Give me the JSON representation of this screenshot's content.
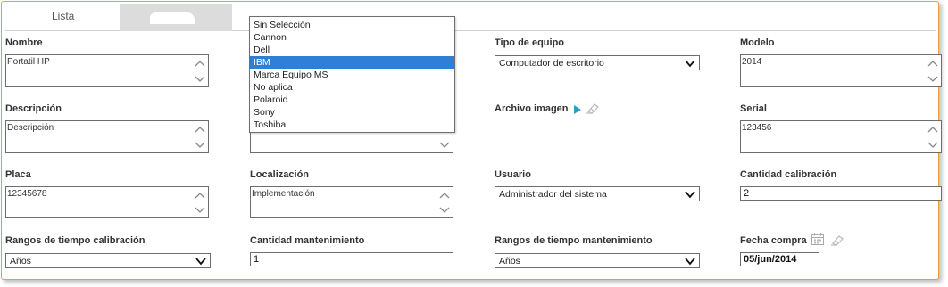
{
  "tabs": {
    "lista": "Lista"
  },
  "form": {
    "nombre": {
      "label": "Nombre",
      "value": "Portatil HP"
    },
    "marca_dropdown": {
      "options": [
        "Sin Selección",
        "Cannon",
        "Dell",
        "IBM",
        "Marca Equipo MS",
        "No aplica",
        "Polaroid",
        "Sony",
        "Toshiba"
      ],
      "selected_index": 3
    },
    "tipo_equipo": {
      "label": "Tipo de equipo",
      "value": "Computador de escritorio"
    },
    "modelo": {
      "label": "Modelo",
      "value": "2014"
    },
    "descripcion": {
      "label": "Descripción",
      "value": "Descripción"
    },
    "archivo_imagen": {
      "label": "Archivo imagen"
    },
    "serial": {
      "label": "Serial",
      "value": "123456"
    },
    "placa": {
      "label": "Placa",
      "value": "12345678"
    },
    "localizacion": {
      "label": "Localización",
      "value": "Implementación"
    },
    "usuario": {
      "label": "Usuario",
      "value": "Administrador del sistema"
    },
    "cantidad_calibracion": {
      "label": "Cantidad calibración",
      "value": "2"
    },
    "rangos_calibracion": {
      "label": "Rangos de tiempo calibración",
      "value": "Años"
    },
    "cantidad_mantenimiento": {
      "label": "Cantidad mantenimiento",
      "value": "1"
    },
    "rangos_mantenimiento": {
      "label": "Rangos de tiempo mantenimiento",
      "value": "Años"
    },
    "fecha_compra": {
      "label": "Fecha compra",
      "value": "05/jun/2014"
    }
  },
  "colors": {
    "frame_border": "#f19a3e",
    "selected_option": "#2f7fd6",
    "archivo_arrow": "#2a9fbf"
  },
  "icons": [
    "chevron-up-icon",
    "chevron-down-icon",
    "play-arrow-icon",
    "eraser-icon",
    "calendar-icon"
  ]
}
